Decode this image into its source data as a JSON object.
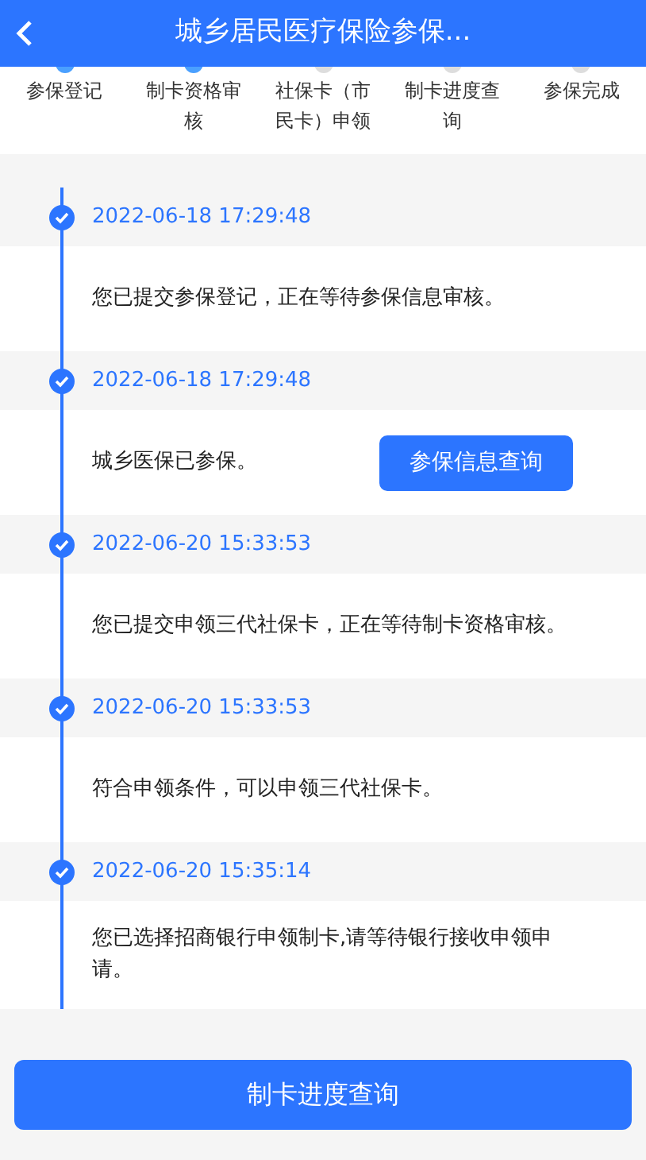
{
  "header": {
    "title": "城乡居民医疗保险参保..."
  },
  "steps": [
    {
      "label": "参保登记",
      "done": true
    },
    {
      "label": "制卡资格审核",
      "done": true
    },
    {
      "label": "社保卡（市民卡）申领",
      "done": false
    },
    {
      "label": "制卡进度查询",
      "done": false
    },
    {
      "label": "参保完成",
      "done": false
    }
  ],
  "timeline": [
    {
      "time": "2022-06-18 17:29:48",
      "message": "您已提交参保登记，正在等待参保信息审核。"
    },
    {
      "time": "2022-06-18 17:29:48",
      "message": "城乡医保已参保。",
      "button": "参保信息查询"
    },
    {
      "time": "2022-06-20 15:33:53",
      "message": "您已提交申领三代社保卡，正在等待制卡资格审核。"
    },
    {
      "time": "2022-06-20 15:33:53",
      "message": "符合申领条件，可以申领三代社保卡。"
    },
    {
      "time": "2022-06-20 15:35:14",
      "message": "您已选择招商银行申领制卡,请等待银行接收申领申请。"
    }
  ],
  "bottom_button": "制卡进度查询"
}
